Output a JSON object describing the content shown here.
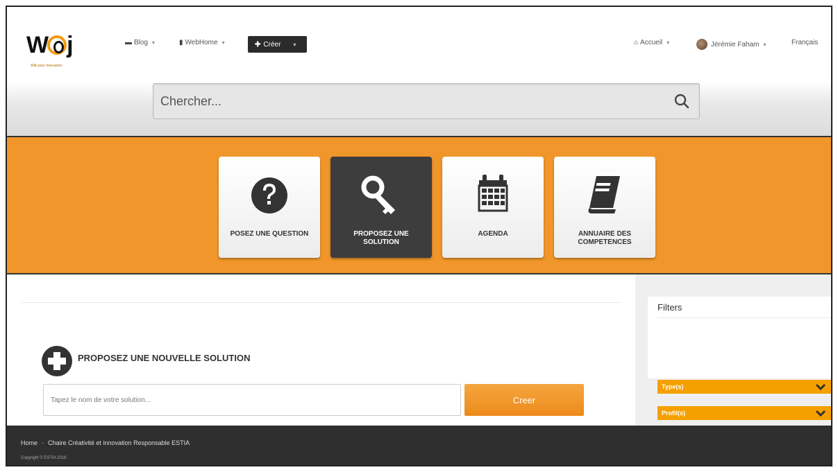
{
  "logo": {
    "text": "W",
    "tagline": "Wiki pour Innovation"
  },
  "nav": {
    "blog": "Blog",
    "webhome": "WebHome",
    "create": "Créer",
    "accueil": "Accueil",
    "user": "Jérémie Faham",
    "language": "Français"
  },
  "search": {
    "placeholder": "Chercher..."
  },
  "tiles": [
    {
      "label": "POSEZ UNE QUESTION",
      "icon": "question-icon",
      "active": false
    },
    {
      "label": "PROPOSEZ UNE SOLUTION",
      "icon": "key-icon",
      "active": true
    },
    {
      "label": "AGENDA",
      "icon": "calendar-icon",
      "active": false
    },
    {
      "label": "ANNUAIRE DES COMPETENCES",
      "icon": "book-icon",
      "active": false
    }
  ],
  "propose": {
    "title": "PROPOSEZ UNE NOUVELLE SOLUTION",
    "input_placeholder": "Tapez le nom de votre solution...",
    "button": "Creer"
  },
  "filters": {
    "title": "Filters",
    "dropdowns": [
      "Type(s)",
      "Profil(s)"
    ]
  },
  "footer": {
    "breadcrumb": [
      "Home",
      "Chaire Créativité et innovation Responsable ESTIA"
    ],
    "copyright": "Copyright © ESTIA 2016"
  },
  "colors": {
    "accent": "#f0962a",
    "dark": "#2f2f2f",
    "filter": "#f5a000"
  }
}
